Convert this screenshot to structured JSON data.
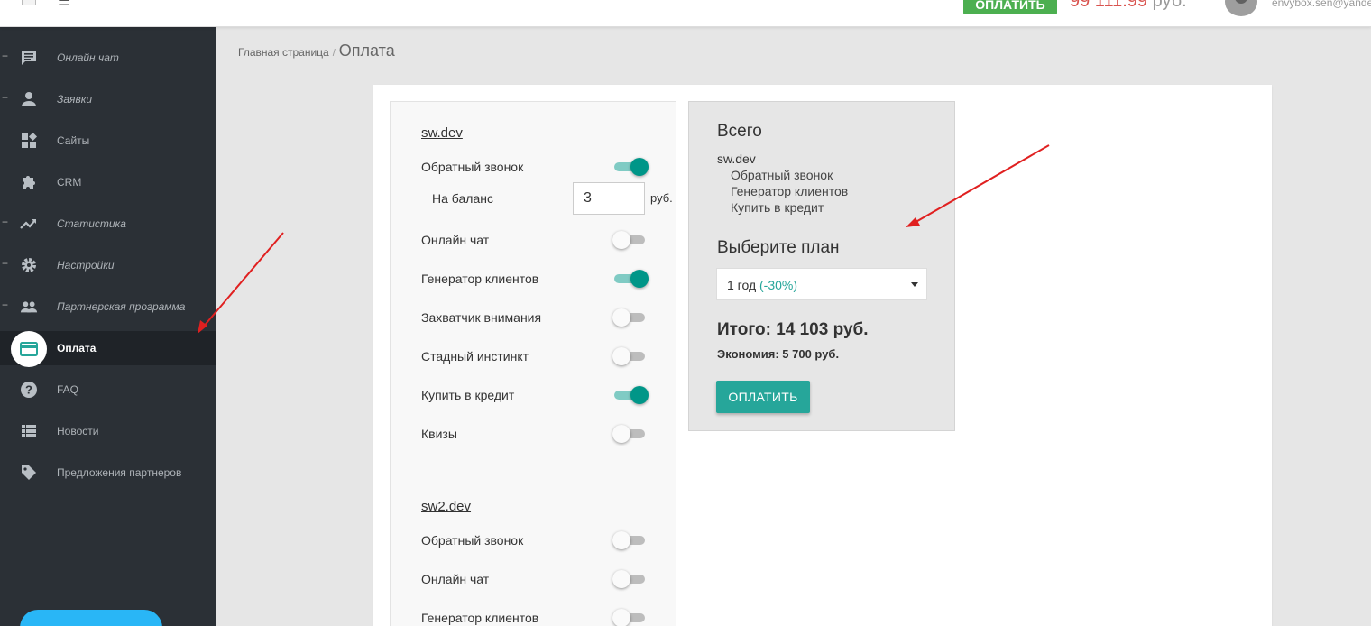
{
  "header": {
    "pay_label": "ОПЛАТИТЬ",
    "balance": "99 111.99",
    "balance_currency": "руб.",
    "email": "envybox.sen@yandex"
  },
  "sidebar": {
    "items": [
      {
        "label": "Онлайн чат",
        "icon": "chat-icon",
        "expandable": true
      },
      {
        "label": "Заявки",
        "icon": "person-icon",
        "expandable": true
      },
      {
        "label": "Сайты",
        "icon": "widgets-icon",
        "expandable": false
      },
      {
        "label": "CRM",
        "icon": "puzzle-icon",
        "expandable": false
      },
      {
        "label": "Статистика",
        "icon": "trending-icon",
        "expandable": true
      },
      {
        "label": "Настройки",
        "icon": "gear-icon",
        "expandable": true
      },
      {
        "label": "Партнерская программа",
        "icon": "people-icon",
        "expandable": true
      },
      {
        "label": "Оплата",
        "icon": "credit-card-icon",
        "expandable": false,
        "active": true
      },
      {
        "label": "FAQ",
        "icon": "help-icon",
        "expandable": false
      },
      {
        "label": "Новости",
        "icon": "list-icon",
        "expandable": false
      },
      {
        "label": "Предложения партнеров",
        "icon": "tag-icon",
        "expandable": false
      }
    ]
  },
  "breadcrumb": {
    "home": "Главная страница",
    "separator": "/",
    "current": "Оплата"
  },
  "sites": [
    {
      "name": "sw.dev",
      "balance_label": "На баланс",
      "balance_value": "3",
      "balance_unit": "руб.",
      "options": [
        {
          "label": "Обратный звонок",
          "enabled": true
        },
        {
          "label": "Онлайн чат",
          "enabled": false
        },
        {
          "label": "Генератор клиентов",
          "enabled": true
        },
        {
          "label": "Захватчик внимания",
          "enabled": false
        },
        {
          "label": "Стадный инстинкт",
          "enabled": false
        },
        {
          "label": "Купить в кредит",
          "enabled": true
        },
        {
          "label": "Квизы",
          "enabled": false
        }
      ]
    },
    {
      "name": "sw2.dev",
      "options": [
        {
          "label": "Обратный звонок",
          "enabled": false
        },
        {
          "label": "Онлайн чат",
          "enabled": false
        },
        {
          "label": "Генератор клиентов",
          "enabled": false
        }
      ]
    }
  ],
  "summary": {
    "title": "Всего",
    "site": "sw.dev",
    "items": [
      "Обратный звонок",
      "Генератор клиентов",
      "Купить в кредит"
    ],
    "plan_title": "Выберите план",
    "plan_value": "1 год",
    "plan_discount": "(-30%)",
    "total": "Итого: 14 103 руб.",
    "savings": "Экономия: 5 700 руб.",
    "pay_label": "ОПЛАТИТЬ"
  },
  "colors": {
    "accent": "#26a69a",
    "toggle_on": "#009688",
    "sidebar_bg": "#2b3036",
    "top_pay": "#4caf50",
    "balance": "#d9534f",
    "arrow": "#e02020"
  }
}
